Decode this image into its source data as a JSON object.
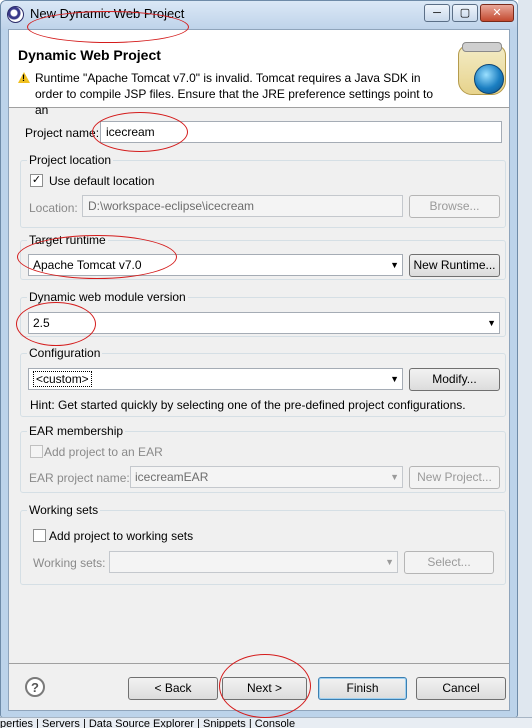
{
  "window": {
    "title": "New Dynamic Web Project",
    "minimize": "─",
    "maximize": "▢",
    "close": "✕"
  },
  "header": {
    "title": "Dynamic Web Project",
    "warning": "Runtime \"Apache Tomcat v7.0\" is invalid. Tomcat requires a Java SDK in order to compile JSP files. Ensure that the JRE preference settings point to an"
  },
  "project": {
    "name_label": "Project name:",
    "name_value": "icecream"
  },
  "location": {
    "group_label": "Project location",
    "use_default_label": "Use default location",
    "use_default_checked": "✓",
    "location_label": "Location:",
    "location_value": "D:\\workspace-eclipse\\icecream",
    "browse_label": "Browse..."
  },
  "runtime": {
    "group_label": "Target runtime",
    "selected": "Apache Tomcat v7.0",
    "new_runtime_label": "New Runtime..."
  },
  "module": {
    "group_label": "Dynamic web module version",
    "selected": "2.5"
  },
  "configuration": {
    "group_label": "Configuration",
    "selected": "<custom>",
    "modify_label": "Modify...",
    "hint": "Hint: Get started quickly by selecting one of the pre-defined project configurations."
  },
  "ear": {
    "group_label": "EAR membership",
    "add_label": "Add project to an EAR",
    "project_name_label": "EAR project name:",
    "project_name_value": "icecreamEAR",
    "new_project_label": "New Project..."
  },
  "working_sets": {
    "group_label": "Working sets",
    "add_label": "Add project to working sets",
    "sets_label": "Working sets:",
    "select_label": "Select..."
  },
  "footer": {
    "help": "?",
    "back_label": "< Back",
    "next_label": "Next >",
    "finish_label": "Finish",
    "cancel_label": "Cancel"
  },
  "statusbar": {
    "text": "perties | Servers | Data Source Explorer | Snippets | Console"
  },
  "colors": {
    "annotation": "#d41c1c",
    "window_frame": "#bcd3ea",
    "dialog_bg": "#f0f0f0",
    "warning": "#f0c020"
  },
  "icons": [
    "eclipse-app-icon",
    "warning-icon",
    "wizard-banner-icon",
    "help-icon"
  ]
}
